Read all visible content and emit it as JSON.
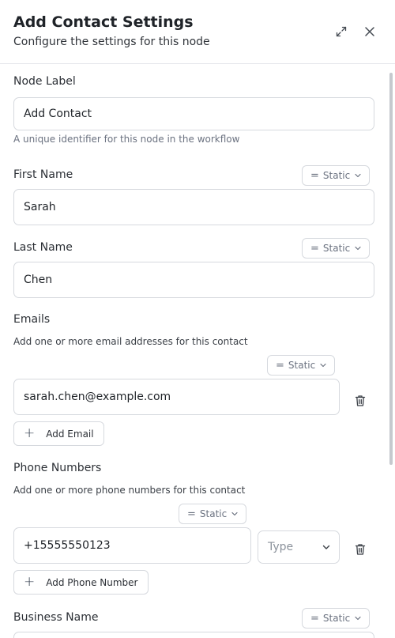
{
  "header": {
    "title": "Add Contact Settings",
    "subtitle": "Configure the settings for this node",
    "expand_icon": "expand-icon",
    "close_icon": "close-icon"
  },
  "node_label": {
    "label": "Node Label",
    "value": "Add Contact",
    "hint": "A unique identifier for this node in the workflow"
  },
  "first_name": {
    "label": "First Name",
    "mode": "Static",
    "value": "Sarah"
  },
  "last_name": {
    "label": "Last Name",
    "mode": "Static",
    "value": "Chen"
  },
  "emails": {
    "label": "Emails",
    "help": "Add one or more email addresses for this contact",
    "mode": "Static",
    "value": "sarah.chen@example.com",
    "add_label": "Add Email"
  },
  "phones": {
    "label": "Phone Numbers",
    "help": "Add one or more phone numbers for this contact",
    "mode": "Static",
    "value": "+15555550123",
    "type_placeholder": "Type",
    "add_label": "Add Phone Number"
  },
  "business_name": {
    "label": "Business Name",
    "mode": "Static"
  },
  "colors": {
    "border": "#d6d9de",
    "text": "#1f2328",
    "muted": "#6b7280"
  }
}
